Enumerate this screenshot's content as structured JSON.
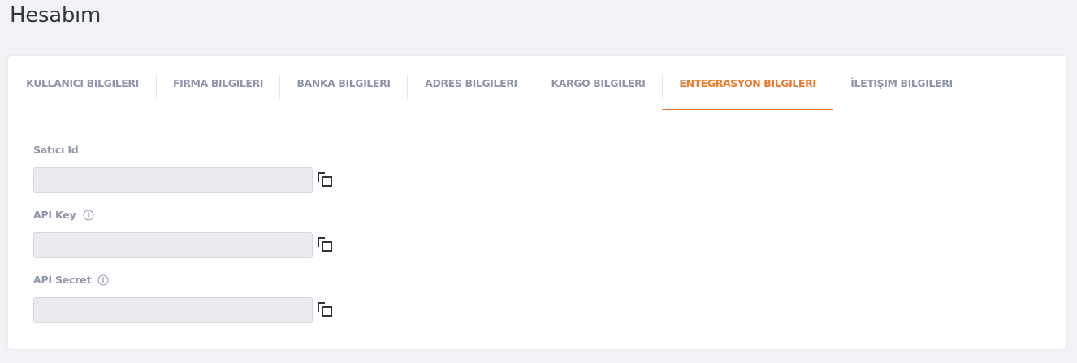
{
  "page": {
    "title": "Hesabım"
  },
  "tabs": [
    {
      "label": "KULLANICI BILGILERI",
      "active": false
    },
    {
      "label": "FIRMA BILGILERI",
      "active": false
    },
    {
      "label": "BANKA BILGILERI",
      "active": false
    },
    {
      "label": "ADRES BILGILERI",
      "active": false
    },
    {
      "label": "KARGO BILGILERI",
      "active": false
    },
    {
      "label": "ENTEGRASYON BILGILERI",
      "active": true
    },
    {
      "label": "İLETIŞIM BILGILERI",
      "active": false
    }
  ],
  "form": {
    "fields": [
      {
        "label": "Satıcı Id",
        "value": "",
        "has_info": false
      },
      {
        "label": "API Key",
        "value": "",
        "has_info": true
      },
      {
        "label": "API Secret",
        "value": "",
        "has_info": true
      }
    ]
  },
  "colors": {
    "accent": "#ec7a2e",
    "tab_text": "#9096a9",
    "input_bg": "#e9ebee",
    "page_bg": "#f1f2f6"
  },
  "icons": {
    "copy": "copy-icon",
    "info": "info-icon"
  }
}
